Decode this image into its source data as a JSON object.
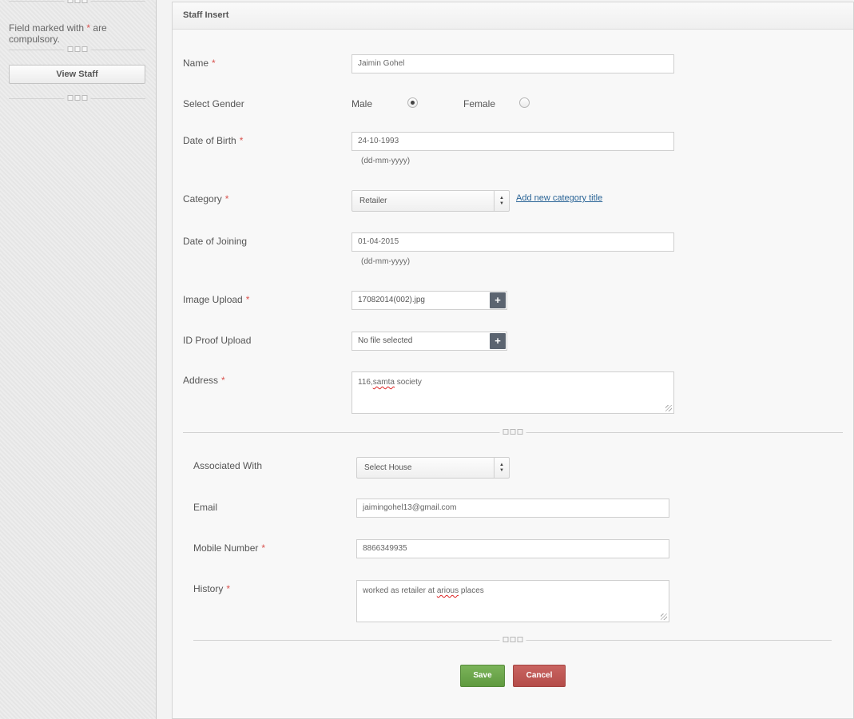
{
  "sidebar": {
    "note_prefix": "Field marked with",
    "note_star": "*",
    "note_suffix": "are compulsory.",
    "view_staff_label": "View Staff"
  },
  "panel": {
    "title": "Staff Insert"
  },
  "form": {
    "required_mark": "*",
    "name": {
      "label": "Name",
      "value": "Jaimin Gohel"
    },
    "gender": {
      "label": "Select Gender",
      "male_label": "Male",
      "female_label": "Female",
      "selected": "Male"
    },
    "dob": {
      "label": "Date of Birth",
      "value": "24-10-1993",
      "hint": "(dd-mm-yyyy)"
    },
    "category": {
      "label": "Category",
      "selected": "Retailer",
      "add_link": "Add new category title"
    },
    "doj": {
      "label": "Date of Joining",
      "value": "01-04-2015",
      "hint": "(dd-mm-yyyy)"
    },
    "image_upload": {
      "label": "Image Upload",
      "file": "17082014(002).jpg",
      "button": "+"
    },
    "id_proof": {
      "label": "ID Proof Upload",
      "file": "No file selected",
      "button": "+"
    },
    "address": {
      "label": "Address",
      "value_a": "116,",
      "value_b": "samta",
      "value_c": " society"
    },
    "associated": {
      "label": "Associated With",
      "selected": "Select House"
    },
    "email": {
      "label": "Email",
      "value": "jaimingohel13@gmail.com"
    },
    "mobile": {
      "label": "Mobile Number",
      "value": "8866349935"
    },
    "history": {
      "label": "History",
      "value_a": "worked as retailer at ",
      "value_b": "arious",
      "value_c": " places"
    },
    "save_label": "Save",
    "cancel_label": "Cancel"
  },
  "colors": {
    "required": "#d9534f",
    "save": "#6aa84f",
    "cancel": "#bd5552",
    "link": "#2a6496"
  }
}
